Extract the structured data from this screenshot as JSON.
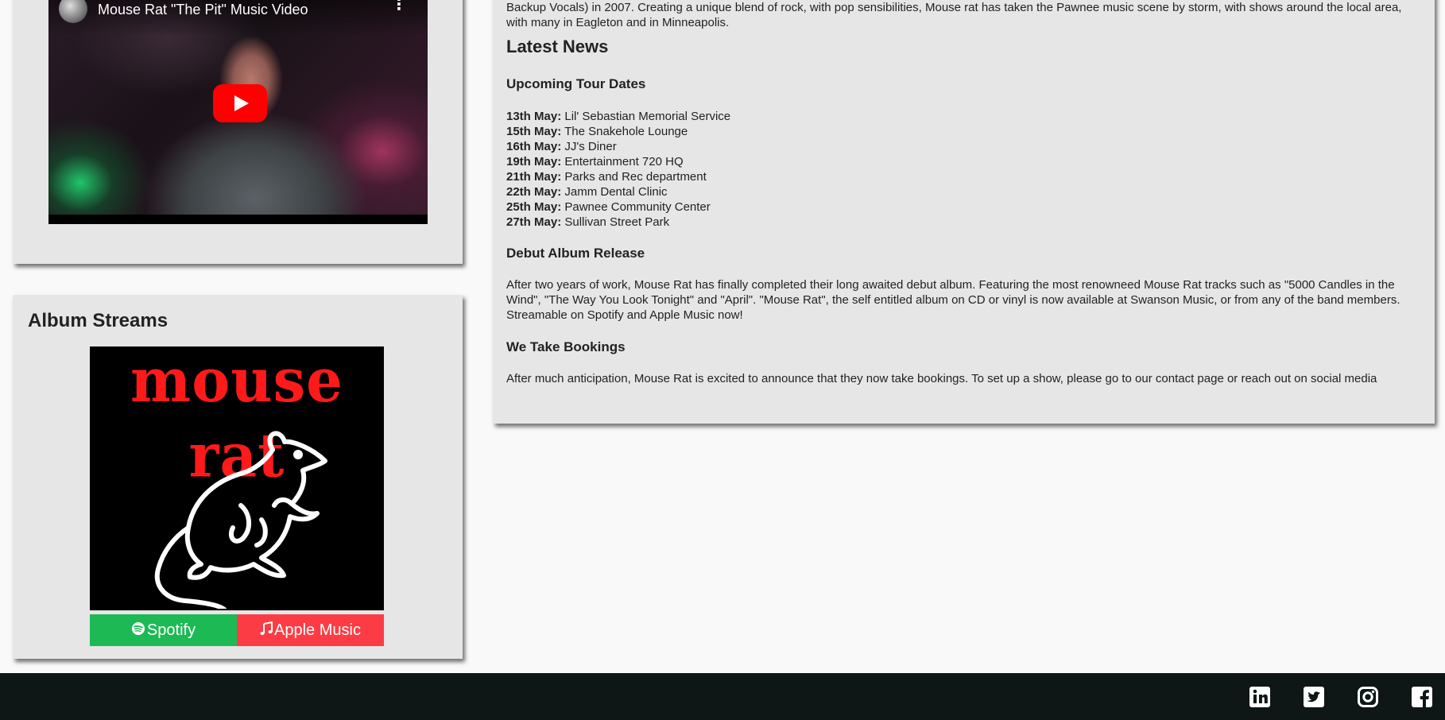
{
  "video": {
    "title": "Mouse Rat \"The Pit\" Music Video",
    "menu_glyph": "⋮"
  },
  "album": {
    "heading": "Album Streams",
    "cover_text": "mouse rat",
    "spotify_label": "Spotify",
    "spotify_icon": "spotify-icon",
    "apple_label": "Apple Music",
    "apple_icon": "music-note-icon",
    "spotify_color": "#1db954",
    "apple_color": "#fc3c44"
  },
  "intro": {
    "text": "Backup Vocals) in 2007. Creating a unique blend of rock, with pop sensibilities, Mouse rat has taken the Pawnee music scene by storm, with shows around the local area, with many in Eagleton and in Minneapolis."
  },
  "news": {
    "heading": "Latest News",
    "tour": {
      "heading": "Upcoming Tour Dates",
      "dates": [
        {
          "date": "13th May:",
          "venue": "Lil' Sebastian Memorial Service"
        },
        {
          "date": "15th May:",
          "venue": "The Snakehole Lounge"
        },
        {
          "date": "16th May:",
          "venue": "JJ's Diner"
        },
        {
          "date": "19th May:",
          "venue": "Entertainment 720 HQ"
        },
        {
          "date": "21th May:",
          "venue": "Parks and Rec department"
        },
        {
          "date": "22th May:",
          "venue": "Jamm Dental Clinic"
        },
        {
          "date": "25th May:",
          "venue": "Pawnee Community Center"
        },
        {
          "date": "27th May:",
          "venue": "Sullivan Street Park"
        }
      ]
    },
    "album_release": {
      "heading": "Debut Album Release",
      "text": "After two years of work, Mouse Rat has finally completed their long awaited debut album. Featuring the most renowneed Mouse Rat tracks such as \"5000 Candles in the Wind\", \"The Way You Look Tonight\" and \"April\". \"Mouse Rat\", the self entitled album on CD or vinyl is now available at Swanson Music, or from any of the band members. Streamable on Spotify and Apple Music now!"
    },
    "bookings": {
      "heading": "We Take Bookings",
      "text": "After much anticipation, Mouse Rat is excited to announce that they now take bookings. To set up a show, please go to our contact page or reach out on social media"
    }
  },
  "footer": {
    "social": [
      "linkedin-icon",
      "twitter-icon",
      "instagram-icon",
      "facebook-icon"
    ],
    "background": "#0e1716"
  }
}
